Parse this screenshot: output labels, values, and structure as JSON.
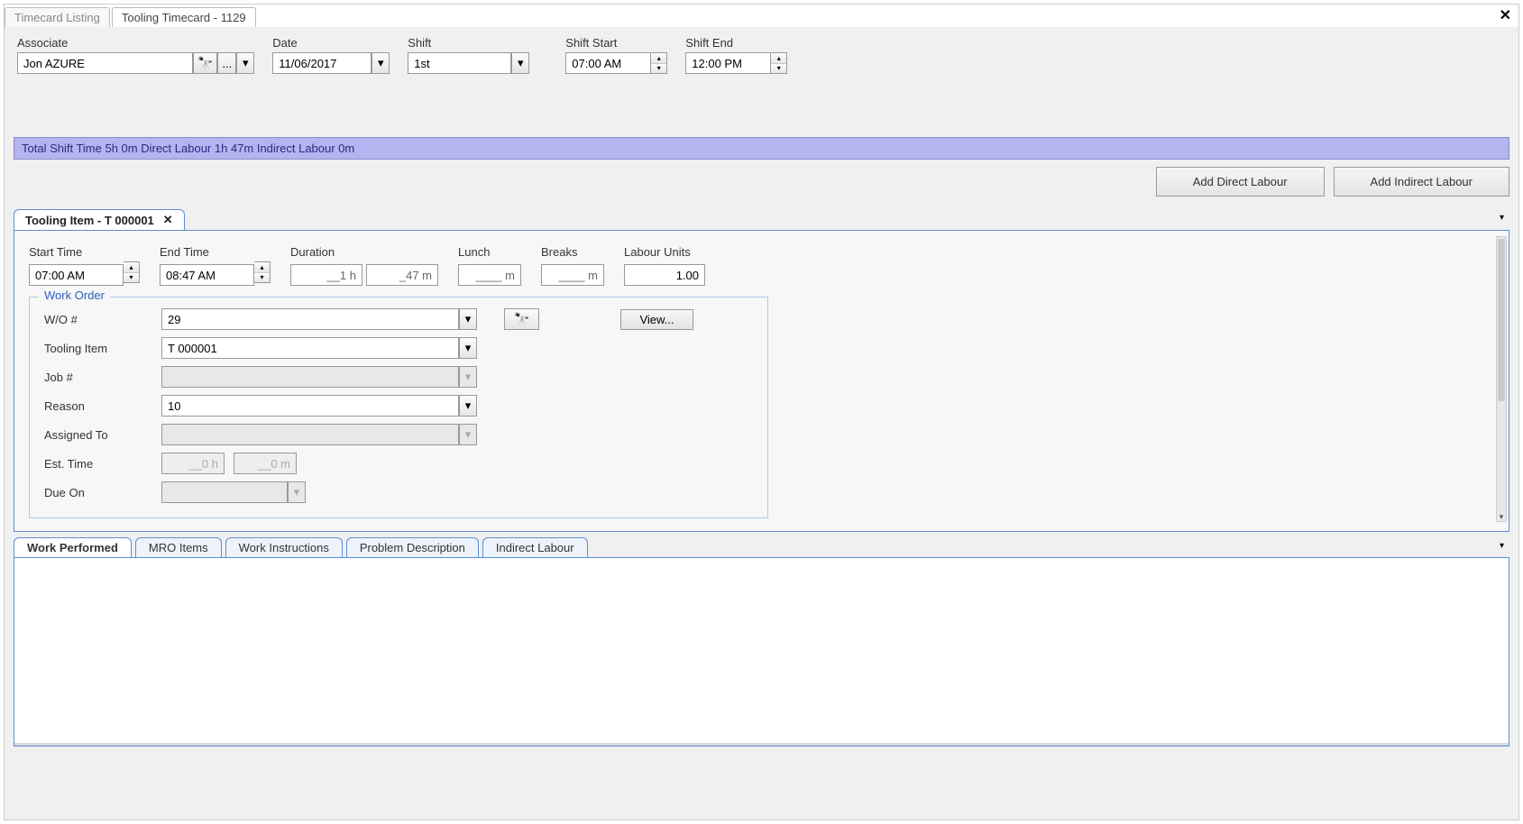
{
  "topTabs": {
    "listing": "Timecard Listing",
    "timecard": "Tooling Timecard - 1129"
  },
  "header": {
    "associateLabel": "Associate",
    "associateValue": "Jon AZURE",
    "dateLabel": "Date",
    "dateValue": "11/06/2017",
    "shiftLabel": "Shift",
    "shiftValue": "1st",
    "shiftStartLabel": "Shift Start",
    "shiftStartValue": "07:00 AM",
    "shiftEndLabel": "Shift End",
    "shiftEndValue": "12:00 PM"
  },
  "summary": "Total Shift Time 5h 0m  Direct Labour 1h 47m  Indirect Labour 0m",
  "actions": {
    "addDirect": "Add Direct Labour",
    "addIndirect": "Add Indirect Labour"
  },
  "itemTab": {
    "title": "Tooling Item - T 000001",
    "startTimeLabel": "Start Time",
    "startTimeValue": "07:00 AM",
    "endTimeLabel": "End Time",
    "endTimeValue": "08:47 AM",
    "durationLabel": "Duration",
    "durationH": "__1 h",
    "durationM": "_47 m",
    "lunchLabel": "Lunch",
    "lunchValue": "____ m",
    "breaksLabel": "Breaks",
    "breaksValue": "____ m",
    "labourUnitsLabel": "Labour Units",
    "labourUnitsValue": "1.00"
  },
  "workOrder": {
    "legend": "Work Order",
    "woNumLabel": "W/O #",
    "woNumValue": "29",
    "viewLabel": "View...",
    "toolingItemLabel": "Tooling Item",
    "toolingItemValue": "T 000001",
    "jobLabel": "Job #",
    "jobValue": "",
    "reasonLabel": "Reason",
    "reasonValue": "10",
    "assignedToLabel": "Assigned To",
    "assignedToValue": "",
    "estTimeLabel": "Est. Time",
    "estH": "__0 h",
    "estM": "__0 m",
    "dueOnLabel": "Due On",
    "dueOnValue": ""
  },
  "bottomTabs": {
    "workPerformed": "Work Performed",
    "mroItems": "MRO Items",
    "workInstructions": "Work Instructions",
    "problemDescription": "Problem Description",
    "indirectLabour": "Indirect Labour"
  },
  "glyphs": {
    "binoculars": "🔭",
    "ellipsis": "...",
    "down": "▾",
    "up": "▴",
    "x": "✕"
  }
}
